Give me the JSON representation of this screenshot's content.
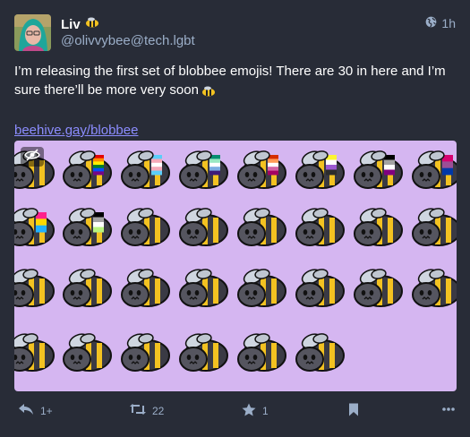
{
  "post": {
    "display_name": "Liv",
    "handle": "@olivvybee@tech.lgbt",
    "time": "1h",
    "content_text": "I’m releasing the first set of blobbee emojis! There are 30 in here and I’m sure there’ll be more very soon",
    "link_text": "beehive.gay/blobbee"
  },
  "actions": {
    "reply_count": "1+",
    "boost_count": "22",
    "favourite_count": "1"
  },
  "colors": {
    "background": "#282c37",
    "media_background": "#d5b6f1",
    "link": "#8c8dff",
    "muted": "#9baec8",
    "bee_yellow": "#f3c221",
    "bee_body": "#3a3a44"
  },
  "icons": [
    "bee-emoji-icon",
    "globe-icon",
    "hide-media-icon",
    "reply-icon",
    "boost-icon",
    "star-icon",
    "bookmark-icon",
    "more-icon"
  ]
}
